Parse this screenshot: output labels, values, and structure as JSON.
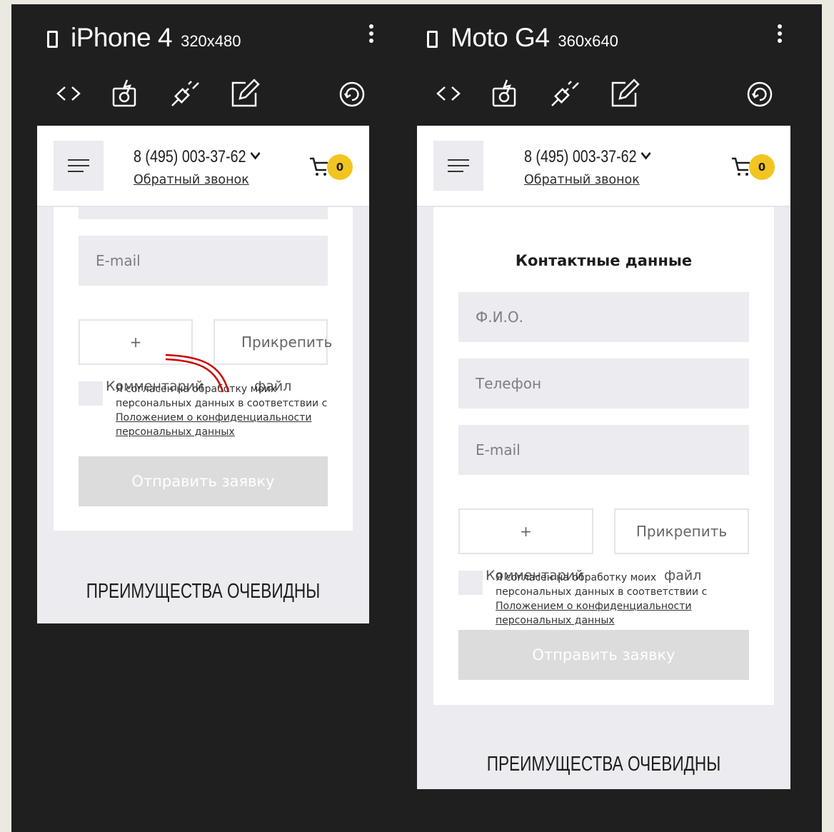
{
  "devices": [
    {
      "name": "iPhone 4",
      "size": "320x480",
      "header": {
        "phone": "8 (495) 003-37-62",
        "callback": "Обратный звонок",
        "cart_count": "0"
      },
      "form": {
        "email_placeholder": "E-mail",
        "plus_label": "+",
        "attach_label": "Прикрепить",
        "comment_overlay": "Комментарий",
        "file_overlay": "файл",
        "consent_text": "Я согласен на обработку моих персональных данных в соответствии с ",
        "consent_link": "Положением о конфиденциальности персональных данных",
        "submit_label": "Отправить заявку"
      },
      "section_title": "ПРЕИМУЩЕСТВА ОЧЕВИДНЫ"
    },
    {
      "name": "Moto G4",
      "size": "360x640",
      "header": {
        "phone": "8 (495) 003-37-62",
        "callback": "Обратный звонок",
        "cart_count": "0"
      },
      "form": {
        "title": "Контактные данные",
        "fio_placeholder": "Ф.И.О.",
        "phone_placeholder": "Телефон",
        "email_placeholder": "E-mail",
        "plus_label": "+",
        "attach_label": "Прикрепить",
        "comment_overlay": "Комментарий",
        "file_overlay": "файл",
        "consent_text": "Я согласен на обработку моих персональных данных в соответствии с ",
        "consent_link": "Положением о конфиденциальности персональных данных",
        "submit_label": "Отправить заявку"
      },
      "section_title": "ПРЕИМУЩЕСТВА ОЧЕВИДНЫ"
    }
  ],
  "toolbar_icons": [
    "code-icon",
    "screenshot-icon",
    "network-icon",
    "edit-icon",
    "rotate-icon"
  ],
  "colors": {
    "background": "#1f1f1f",
    "accent_badge": "#f2c421",
    "field_bg": "#ebebf0",
    "submit_bg": "#dcdcdc",
    "annotation_arrow": "#cc0000"
  }
}
